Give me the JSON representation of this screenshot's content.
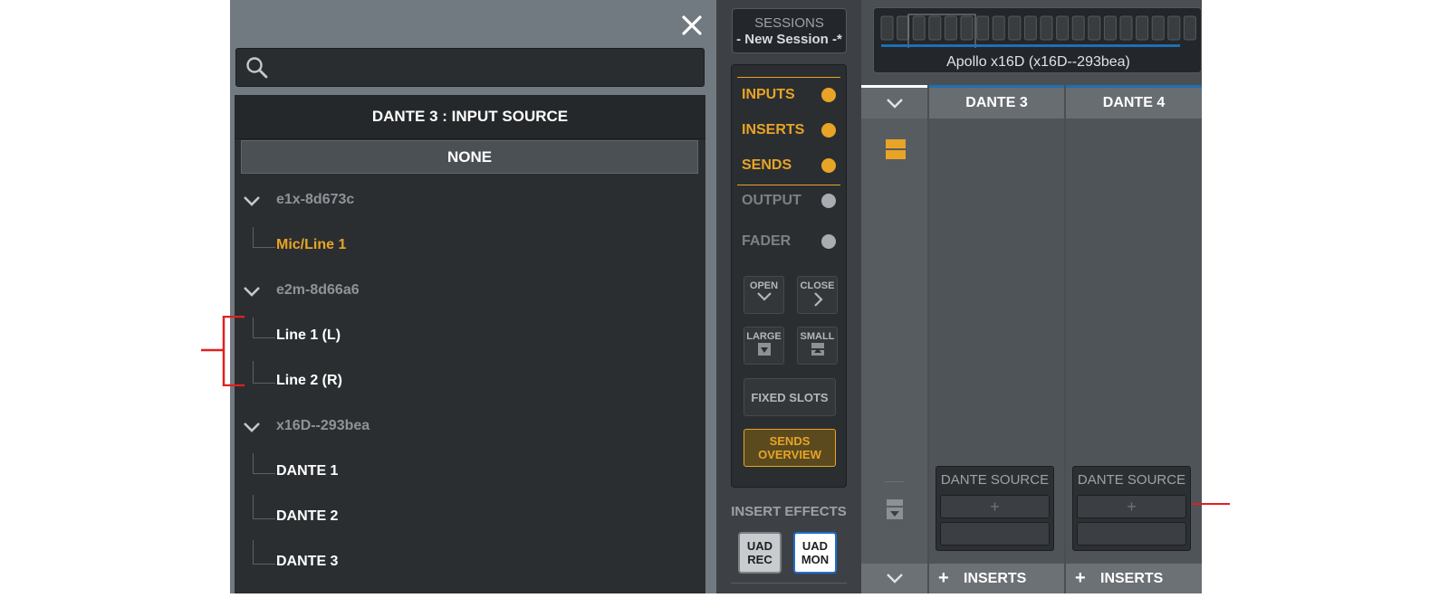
{
  "left_panel": {
    "close_icon": "close-icon",
    "search": {
      "placeholder": "",
      "icon": "search-icon"
    },
    "source_header": "DANTE 3 : INPUT SOURCE",
    "none_label": "NONE",
    "tree": [
      {
        "type": "group",
        "label": "e1x-8d673c"
      },
      {
        "type": "item",
        "label": "Mic/Line 1",
        "active": true
      },
      {
        "type": "group",
        "label": "e2m-8d66a6"
      },
      {
        "type": "item",
        "label": "Line 1 (L)"
      },
      {
        "type": "item",
        "label": "Line 2 (R)"
      },
      {
        "type": "group",
        "label": "x16D--293bea"
      },
      {
        "type": "item",
        "label": "DANTE 1"
      },
      {
        "type": "item",
        "label": "DANTE 2"
      },
      {
        "type": "item",
        "label": "DANTE 3"
      }
    ]
  },
  "middle": {
    "sessions_title": "SESSIONS",
    "session_name": "- New Session -*",
    "view_rows": [
      {
        "label": "INPUTS",
        "state": "on"
      },
      {
        "label": "INSERTS",
        "state": "on"
      },
      {
        "label": "SENDS",
        "state": "on"
      },
      {
        "label": "OUTPUT",
        "state": "off"
      },
      {
        "label": "FADER",
        "state": "off"
      }
    ],
    "open_label": "OPEN",
    "close_label": "CLOSE",
    "large_label": "LARGE",
    "small_label": "SMALL",
    "fixed_slots_label": "FIXED SLOTS",
    "sends_overview_line1": "SENDS",
    "sends_overview_line2": "OVERVIEW",
    "insert_effects_title": "INSERT EFFECTS",
    "uad_rec_line1": "UAD",
    "uad_rec_line2": "REC",
    "uad_mon_line1": "UAD",
    "uad_mon_line2": "MON"
  },
  "mixer": {
    "device_label": "Apollo x16D (x16D--293bea)",
    "channels": [
      {
        "name": "DANTE 3",
        "source_label": "DANTE SOURCE",
        "add_symbol": "+",
        "inserts_label": "INSERTS"
      },
      {
        "name": "DANTE 4",
        "source_label": "DANTE SOURCE",
        "add_symbol": "+",
        "inserts_label": "INSERTS"
      }
    ]
  },
  "colors": {
    "accent": "#e8a426",
    "panel": "#2b2e31",
    "annotation_red": "#e02020",
    "channel_blue": "#1f6fb0"
  }
}
